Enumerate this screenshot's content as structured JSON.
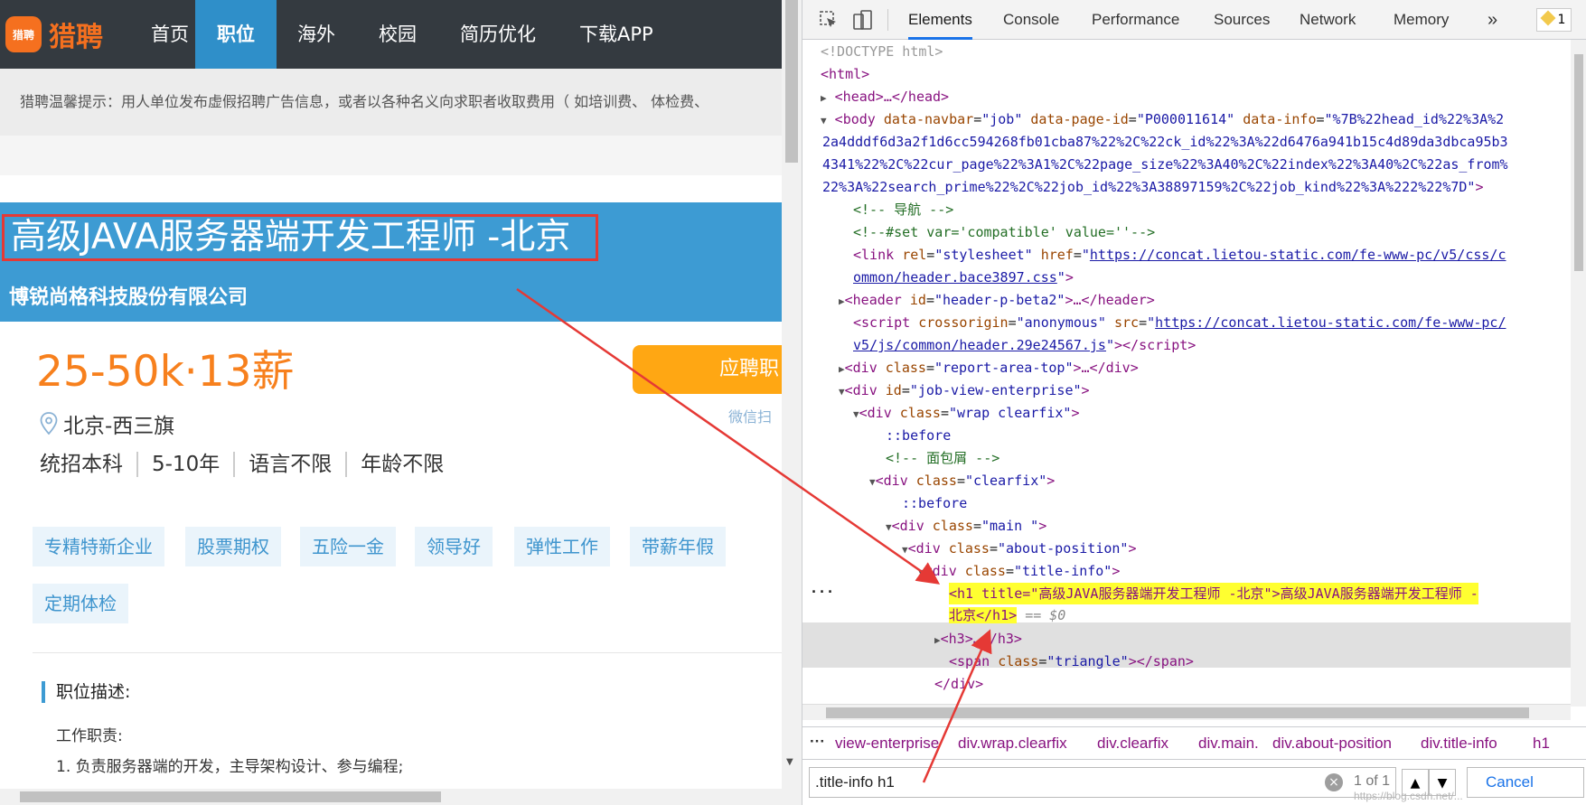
{
  "site": {
    "logo_badge": "猎聘",
    "logo_name": "猎聘",
    "nav": [
      "首页",
      "职位",
      "海外",
      "校园",
      "简历优化",
      "下载APP"
    ],
    "notice": "猎聘温馨提示：用人单位发布虚假招聘广告信息，或者以各种名义向求职者收取费用（ 如培训费、 体检费、"
  },
  "job": {
    "title": "高级JAVA服务器端开发工程师 -北京",
    "company": "博锐尚格科技股份有限公司",
    "salary": "25-50k·13薪",
    "apply_label": "应聘职",
    "wechat_label": "微信扫",
    "location": "北京-西三旗",
    "requirements": [
      "统招本科",
      "5-10年",
      "语言不限",
      "年龄不限"
    ],
    "tags": [
      "专精特新企业",
      "股票期权",
      "五险一金",
      "领导好",
      "弹性工作",
      "带薪年假",
      "定期体检"
    ],
    "description_heading": "职位描述:",
    "duty_label": "工作职责:",
    "duty_1": "1. 负责服务器端的开发，主导架构设计、参与编程;"
  },
  "devtools": {
    "tabs": [
      "Elements",
      "Console",
      "Performance",
      "Sources",
      "Network",
      "Memory"
    ],
    "more": "»",
    "badge": "1",
    "code": {
      "doctype": "<!DOCTYPE html>",
      "html_open": "<html>",
      "head_collapsed": "<head>…</head>",
      "body_tag": "body",
      "body_attr1_name": "data-navbar",
      "body_attr1_value": "\"job\"",
      "body_attr2_name": "data-page-id",
      "body_attr2_value": "\"P000011614\"",
      "body_attr3_name": "data-info",
      "body_info_1": "\"%7B%22head_id%22%3A%2",
      "body_info_2": "2a4dddf6d3a2f1d6cc594268fb01cba87%22%2C%22ck_id%22%3A%22d6476a941b15c4d89da3dbca95b3",
      "body_info_3": "4341%22%2C%22cur_page%22%3A1%2C%22page_size%22%3A40%2C%22index%22%3A40%2C%22as_from%",
      "body_info_4": "22%3A%22search_prime%22%2C%22job_id%22%3A38897159%2C%22job_kind%22%3A%222%22%7D\"",
      "comment_nav": "<!-- 导航 -->",
      "comment_set": "<!--#set var='compatible' value=''-->",
      "link_href_1": "https://concat.lietou-static.com/fe-www-pc/v5/css/c",
      "link_href_2": "ommon/header.bace3897.css",
      "header_id": "\"header-p-beta2\"",
      "script_crossorigin": "\"anonymous\"",
      "script_src_1": "https://concat.lietou-static.com/fe-www-pc/",
      "script_src_2": "v5/js/common/header.29e24567.js",
      "div_report": "\"report-area-top\"",
      "div_enterprise": "\"job-view-enterprise\"",
      "div_wrap": "\"wrap clearfix\"",
      "before": "::before",
      "comment_breadcrumb": "<!-- 面包屑 -->",
      "div_clearfix": "\"clearfix\"",
      "div_main": "\"main \"",
      "div_about": "\"about-position\"",
      "div_titleinfo": "\"title-info\"",
      "h1_line1": "<h1 title=\"高级JAVA服务器端开发工程师 -北京\">高级JAVA服务器端开发工程师 -",
      "h1_line2": "北京</h1>",
      "eq": "== $0",
      "h3_collapsed": "<h3>…</h3>",
      "span_triangle": "\"triangle\"",
      "div_close": "</div>"
    },
    "breadcrumbs": [
      "view-enterprise",
      "div.wrap.clearfix",
      "div.clearfix",
      "div.main.",
      "div.about-position",
      "div.title-info",
      "h1"
    ],
    "search_value": ".title-info h1",
    "search_count": "1 of 1",
    "cancel_label": "Cancel",
    "watermark": "https://blog.csdn.net/..."
  }
}
